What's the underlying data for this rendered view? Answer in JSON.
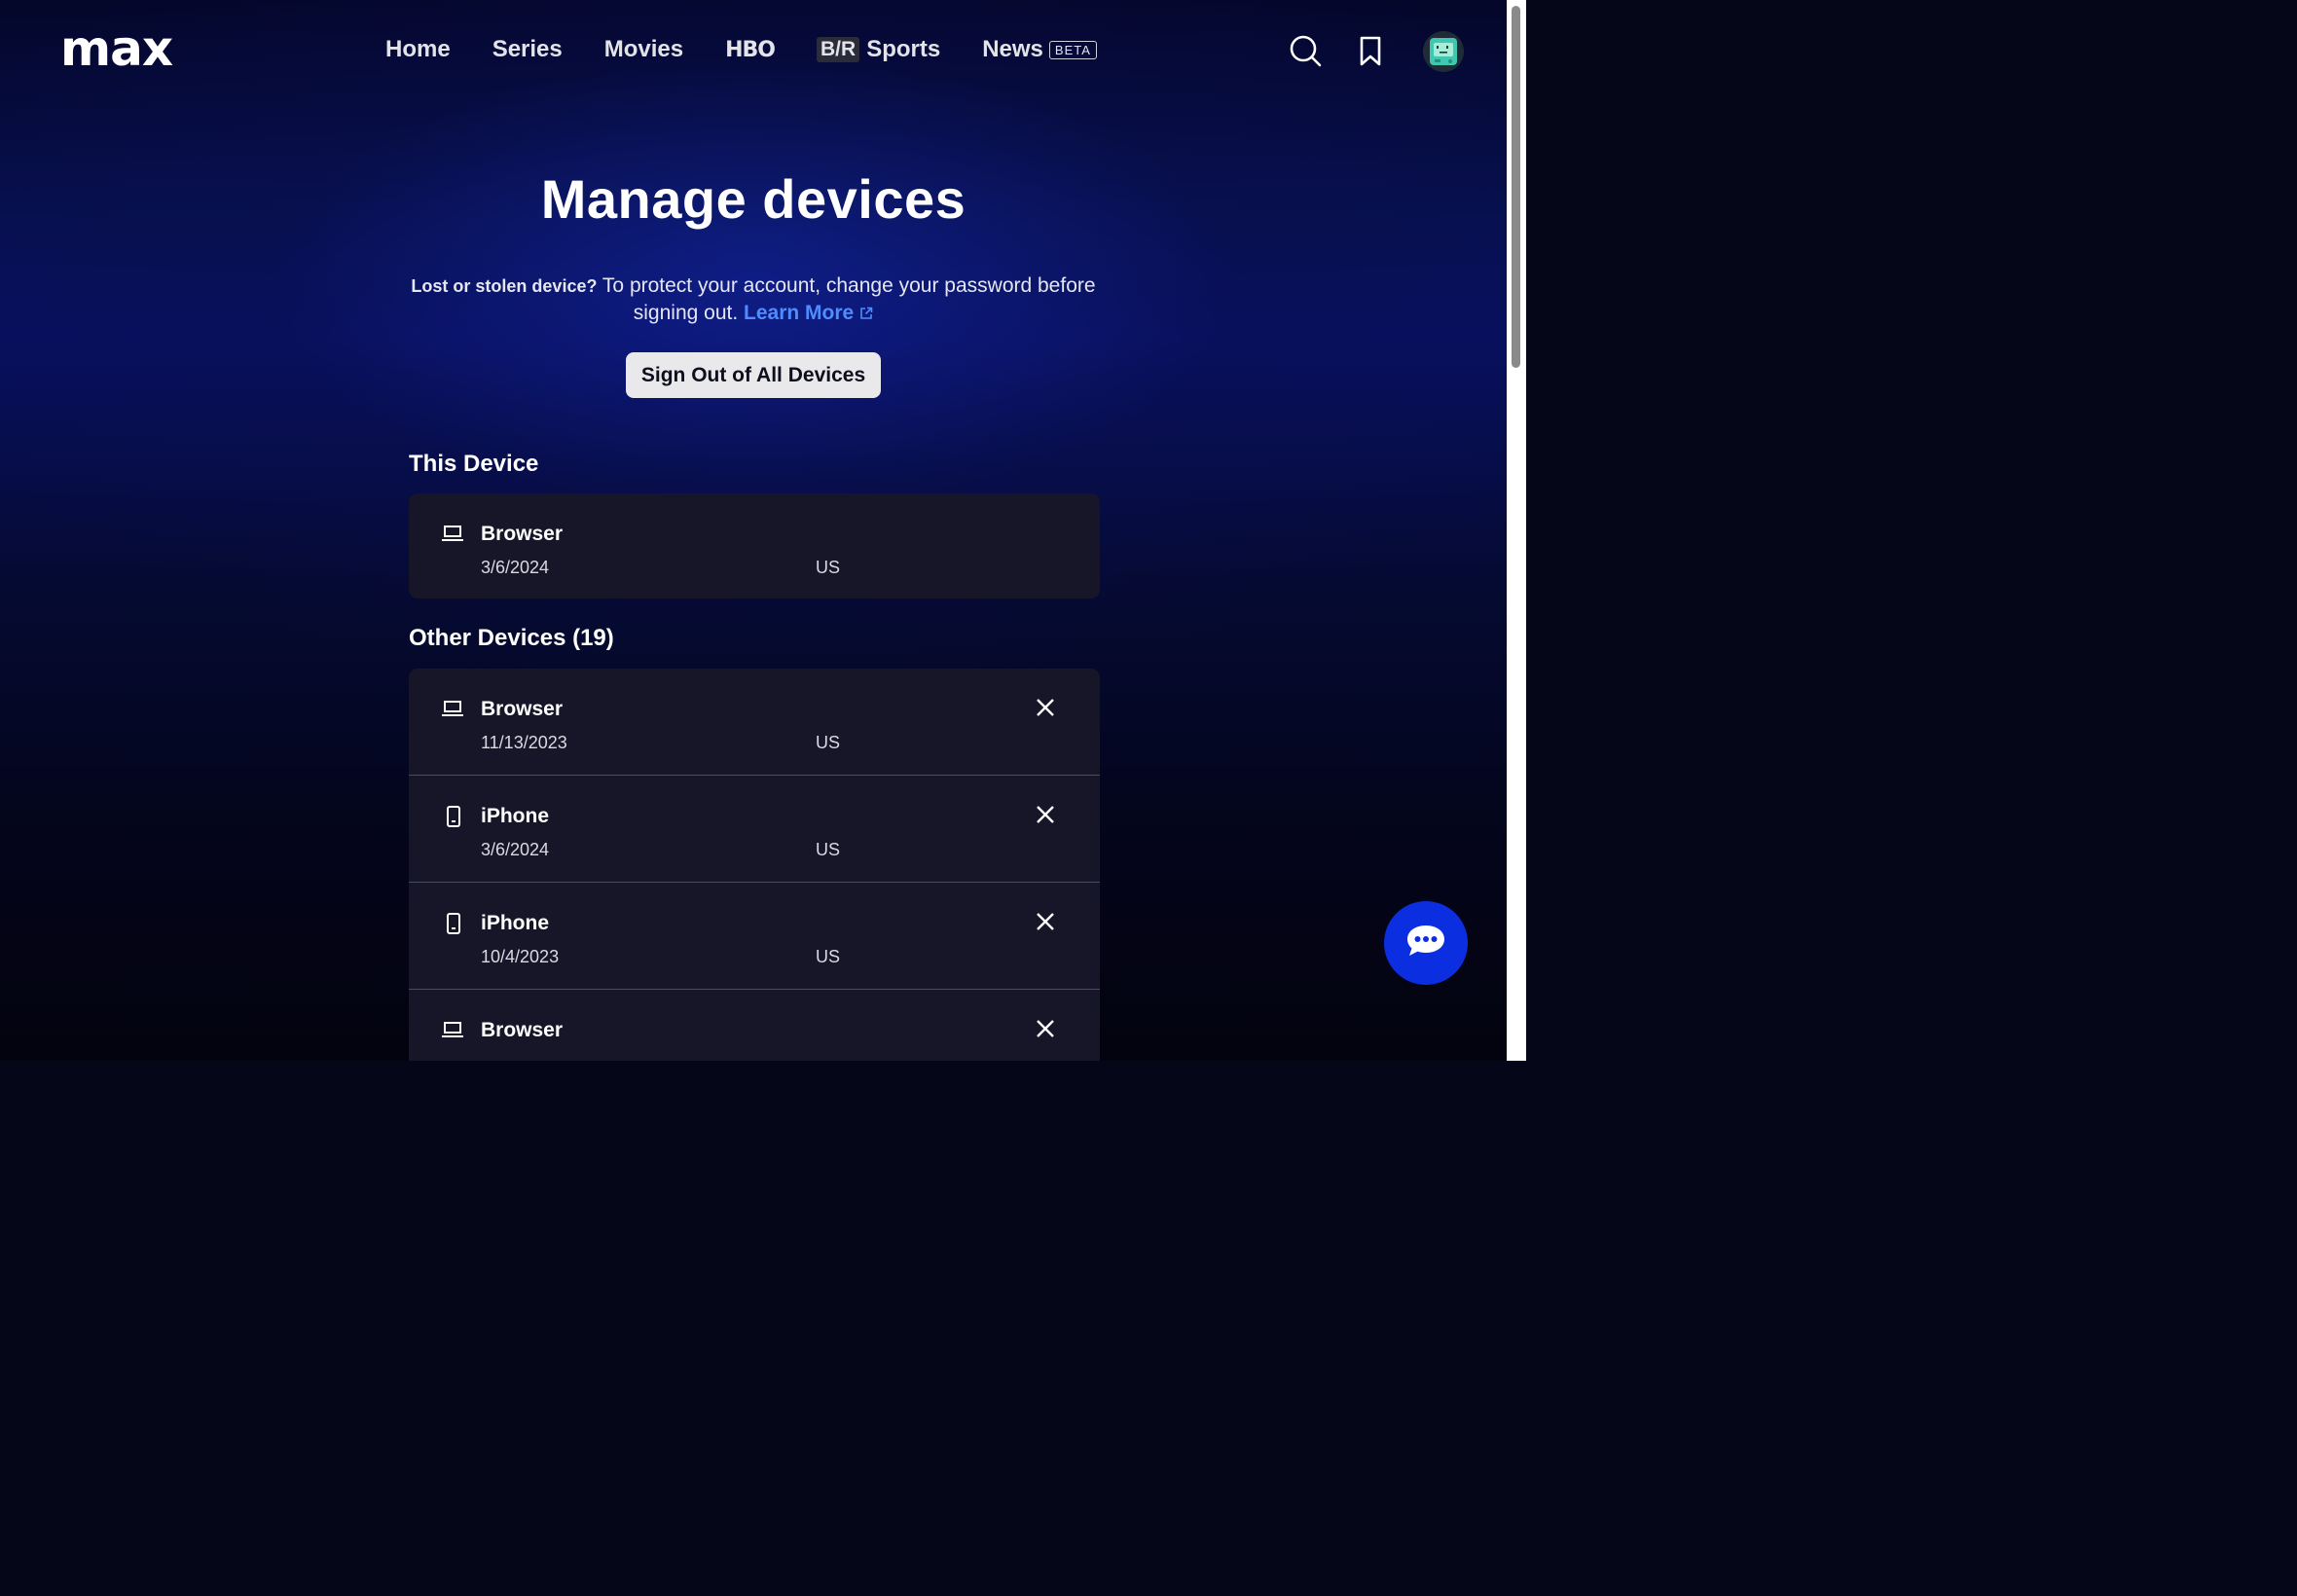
{
  "header": {
    "logo": "max",
    "nav": {
      "home": "Home",
      "series": "Series",
      "movies": "Movies",
      "hbo": "HBO",
      "br_logo": "B/R",
      "sports": "Sports",
      "news": "News",
      "news_badge": "BETA"
    },
    "icons": [
      "search-icon",
      "bookmark-icon",
      "profile-avatar"
    ]
  },
  "main": {
    "title": "Manage devices",
    "notice_bold": "Lost or stolen device?",
    "notice_text": " To protect your account, change your password before signing out. ",
    "learn_more": "Learn More",
    "signout_button": "Sign Out of All Devices",
    "this_device_heading": "This Device",
    "this_device": {
      "name": "Browser",
      "date": "3/6/2024",
      "country": "US",
      "icon": "laptop-icon"
    },
    "other_devices_heading": "Other Devices (19)",
    "other_devices": [
      {
        "name": "Browser",
        "date": "11/13/2023",
        "country": "US",
        "icon": "laptop-icon"
      },
      {
        "name": "iPhone",
        "date": "3/6/2024",
        "country": "US",
        "icon": "phone-icon"
      },
      {
        "name": "iPhone",
        "date": "10/4/2023",
        "country": "US",
        "icon": "phone-icon"
      },
      {
        "name": "Browser",
        "date": "",
        "country": "",
        "icon": "laptop-icon"
      }
    ]
  },
  "colors": {
    "accent_link": "#4f8dff",
    "chat_button": "#0b2fe0",
    "card_background": "#161628"
  }
}
